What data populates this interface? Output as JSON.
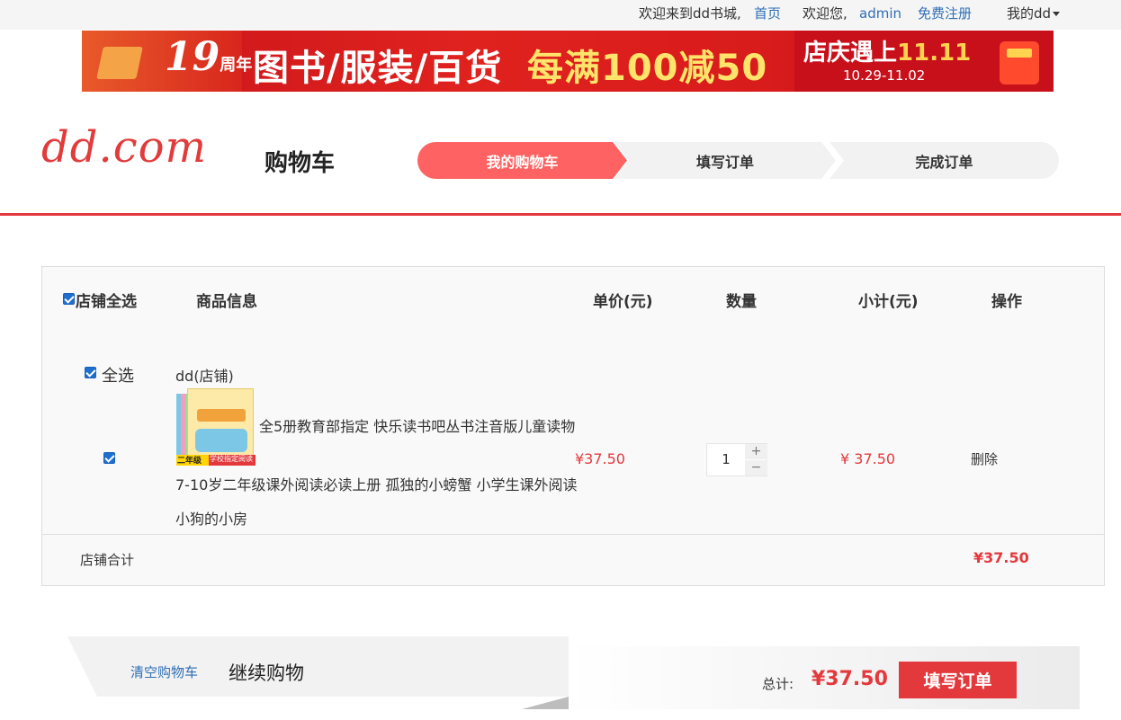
{
  "topbar": {
    "welcome": "欢迎来到dd书城,",
    "home_link": "首页",
    "greeting": "欢迎您,",
    "username": "admin",
    "register_link": "免费注册",
    "my_account": "我的dd"
  },
  "banner": {
    "anniversary_number": "19",
    "anniversary_suffix": "周年",
    "categories": "图书/服装/百货",
    "offer": "每满100减50",
    "promo_prefix": "店庆遇上",
    "promo_highlight": "11.11",
    "dates": "10.29-11.02"
  },
  "header": {
    "logo": "dd.com",
    "page_title": "购物车",
    "steps": [
      "我的购物车",
      "填写订单",
      "完成订单"
    ],
    "active_step": 0
  },
  "cart": {
    "columns": {
      "select_all": "店铺全选",
      "product_info": "商品信息",
      "unit_price": "单价(元)",
      "quantity": "数量",
      "subtotal": "小计(元)",
      "action": "操作"
    },
    "shop": {
      "select_label": "全选",
      "name": "dd(店铺)",
      "item": {
        "title_lines": [
          "全5册教育部指定 快乐读书吧丛书注音版儿童读物",
          "7-10岁二年级课外阅读必读上册 孤独的小螃蟹 小学生课外阅读",
          "小狗的小房"
        ],
        "cover_badge_grade": "二年级",
        "cover_badge_text": "学校指定阅读",
        "price": "¥37.50",
        "quantity": "1",
        "plus": "+",
        "minus": "−",
        "subtotal": "¥ 37.50",
        "delete": "删除",
        "checked": true
      },
      "total_label": "店铺合计",
      "total_value": "¥37.50"
    }
  },
  "footer_bar": {
    "clear_cart": "清空购物车",
    "continue_shopping": "继续购物",
    "total_label": "总计:",
    "total_value": "¥37.50",
    "submit": "填写订单"
  },
  "colors": {
    "accent_red": "#e4393c",
    "active_step": "#ff6262",
    "link_blue": "#2f6fb5"
  }
}
